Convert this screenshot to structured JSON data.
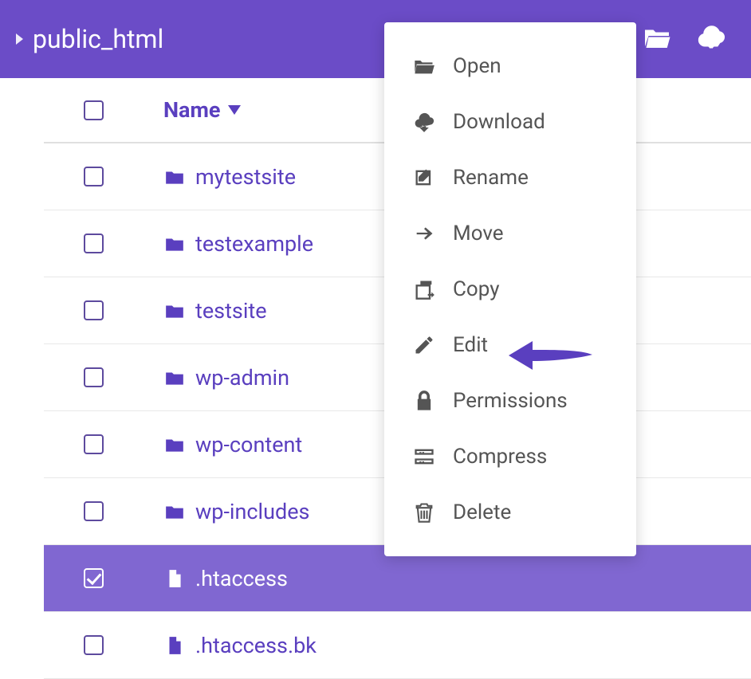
{
  "header": {
    "breadcrumb": "public_html"
  },
  "table": {
    "columns": {
      "name": "Name"
    }
  },
  "rows": [
    {
      "name": "mytestsite",
      "type": "folder",
      "selected": false
    },
    {
      "name": "testexample",
      "type": "folder",
      "selected": false
    },
    {
      "name": "testsite",
      "type": "folder",
      "selected": false
    },
    {
      "name": "wp-admin",
      "type": "folder",
      "selected": false
    },
    {
      "name": "wp-content",
      "type": "folder",
      "selected": false
    },
    {
      "name": "wp-includes",
      "type": "folder",
      "selected": false
    },
    {
      "name": ".htaccess",
      "type": "file",
      "selected": true
    },
    {
      "name": ".htaccess.bk",
      "type": "file",
      "selected": false
    }
  ],
  "context_menu": [
    {
      "label": "Open",
      "icon": "folder-open-icon"
    },
    {
      "label": "Download",
      "icon": "cloud-download-icon"
    },
    {
      "label": "Rename",
      "icon": "rename-icon"
    },
    {
      "label": "Move",
      "icon": "arrow-right-icon"
    },
    {
      "label": "Copy",
      "icon": "copy-icon"
    },
    {
      "label": "Edit",
      "icon": "pencil-icon"
    },
    {
      "label": "Permissions",
      "icon": "lock-icon"
    },
    {
      "label": "Compress",
      "icon": "compress-icon"
    },
    {
      "label": "Delete",
      "icon": "trash-icon"
    }
  ],
  "colors": {
    "brand": "#6b4cc7",
    "accent": "#5a3fbf",
    "selected_row": "#8067d1"
  }
}
